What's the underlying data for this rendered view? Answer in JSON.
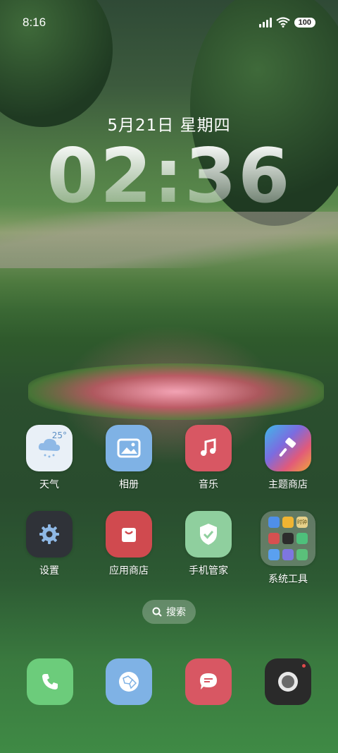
{
  "status_bar": {
    "time": "8:16",
    "battery": "100"
  },
  "lock_clock": {
    "date": "5月21日 星期四",
    "time": "02:36"
  },
  "apps": [
    {
      "name": "weather",
      "label": "天气",
      "temp": "25°",
      "color": "#e9f0f7"
    },
    {
      "name": "gallery",
      "label": "相册",
      "color": "#7fb2e5"
    },
    {
      "name": "music",
      "label": "音乐",
      "color": "#d85763"
    },
    {
      "name": "theme-store",
      "label": "主题商店",
      "color": "#6e6bd8"
    },
    {
      "name": "settings",
      "label": "设置",
      "color": "#2f3238"
    },
    {
      "name": "app-store",
      "label": "应用商店",
      "color": "#d04a4f"
    },
    {
      "name": "phone-manager",
      "label": "手机管家",
      "color": "#8fcf9e"
    },
    {
      "name": "system-tools",
      "label": "系统工具",
      "color": "#c9c9c9"
    }
  ],
  "folder_icons": [
    "#4f8fe8",
    "#f0b432",
    "#e6d08a",
    "#d65050",
    "#2c2c2c",
    "#4ec07b",
    "#5aa0f0",
    "#7e76e0",
    "#5ac07a"
  ],
  "folder_badge_text": "时钟",
  "search": {
    "label": "搜索"
  },
  "dock": [
    {
      "name": "phone",
      "color": "#6ccc7b"
    },
    {
      "name": "browser",
      "color": "#7fb2e5"
    },
    {
      "name": "messages",
      "color": "#d85763"
    },
    {
      "name": "camera",
      "color": "#2a2a2a"
    }
  ]
}
